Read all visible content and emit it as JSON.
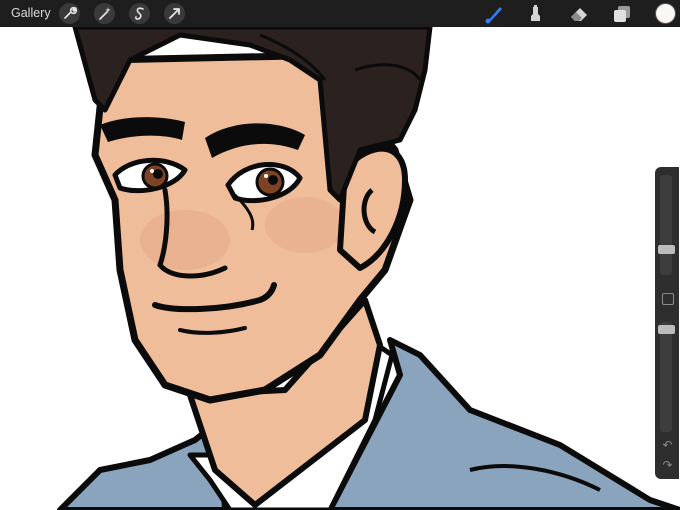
{
  "app": {
    "gallery_label": "Gallery"
  },
  "toolbar": {
    "left_tools": [
      "wrench-icon",
      "magic-wand-icon",
      "selection-icon",
      "transform-arrow-icon"
    ],
    "right_tools": [
      "brush-icon",
      "smudge-icon",
      "eraser-icon",
      "layers-icon"
    ],
    "active_tool": "brush",
    "active_color": "#fbf7f3",
    "accent": "#2f7ff5"
  },
  "sidebar": {
    "brush_size": 0.23,
    "opacity": 0.05,
    "buttons": [
      "modify-button",
      "undo-icon",
      "redo-icon"
    ]
  },
  "colors": {
    "skin": "#efbd9a",
    "hair": "#2b211e",
    "jacket": "#8aa4bd",
    "shirt": "#ffffff",
    "iris": "#7d4324",
    "outline": "#0b0b0b",
    "blush": "#e4a888",
    "bar": "#1e1e1e"
  }
}
